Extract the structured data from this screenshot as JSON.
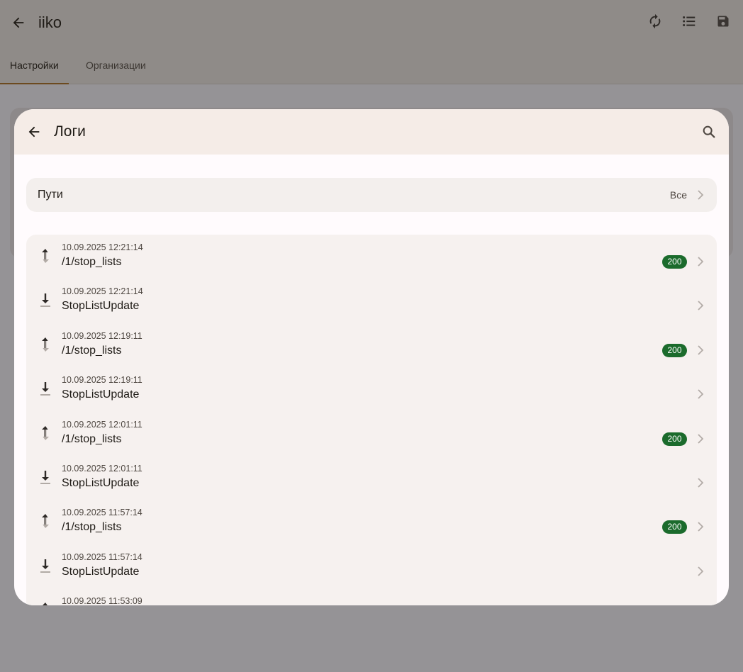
{
  "app": {
    "title": "iiko",
    "actions": [
      {
        "name": "refresh-icon"
      },
      {
        "name": "list-icon"
      },
      {
        "name": "save-icon"
      }
    ]
  },
  "tabs": [
    {
      "label": "Настройки",
      "active": true
    },
    {
      "label": "Организации",
      "active": false
    }
  ],
  "dialog": {
    "title": "Логи",
    "filter": {
      "label": "Пути",
      "value": "Все"
    },
    "logs": [
      {
        "direction": "outgoing",
        "time": "10.09.2025 12:21:14",
        "path": "/1/stop_lists",
        "status": "200"
      },
      {
        "direction": "incoming",
        "time": "10.09.2025 12:21:14",
        "path": "StopListUpdate",
        "status": ""
      },
      {
        "direction": "outgoing",
        "time": "10.09.2025 12:19:11",
        "path": "/1/stop_lists",
        "status": "200"
      },
      {
        "direction": "incoming",
        "time": "10.09.2025 12:19:11",
        "path": "StopListUpdate",
        "status": ""
      },
      {
        "direction": "outgoing",
        "time": "10.09.2025 12:01:11",
        "path": "/1/stop_lists",
        "status": "200"
      },
      {
        "direction": "incoming",
        "time": "10.09.2025 12:01:11",
        "path": "StopListUpdate",
        "status": ""
      },
      {
        "direction": "outgoing",
        "time": "10.09.2025 11:57:14",
        "path": "/1/stop_lists",
        "status": "200"
      },
      {
        "direction": "incoming",
        "time": "10.09.2025 11:57:14",
        "path": "StopListUpdate",
        "status": ""
      },
      {
        "direction": "outgoing",
        "time": "10.09.2025 11:53:09",
        "path": "",
        "status": ""
      }
    ]
  },
  "colors": {
    "status_success": "#1b6b2c",
    "header_bg": "#f5ece7",
    "list_bg": "#f6f1ef",
    "scrim": "#959396"
  }
}
